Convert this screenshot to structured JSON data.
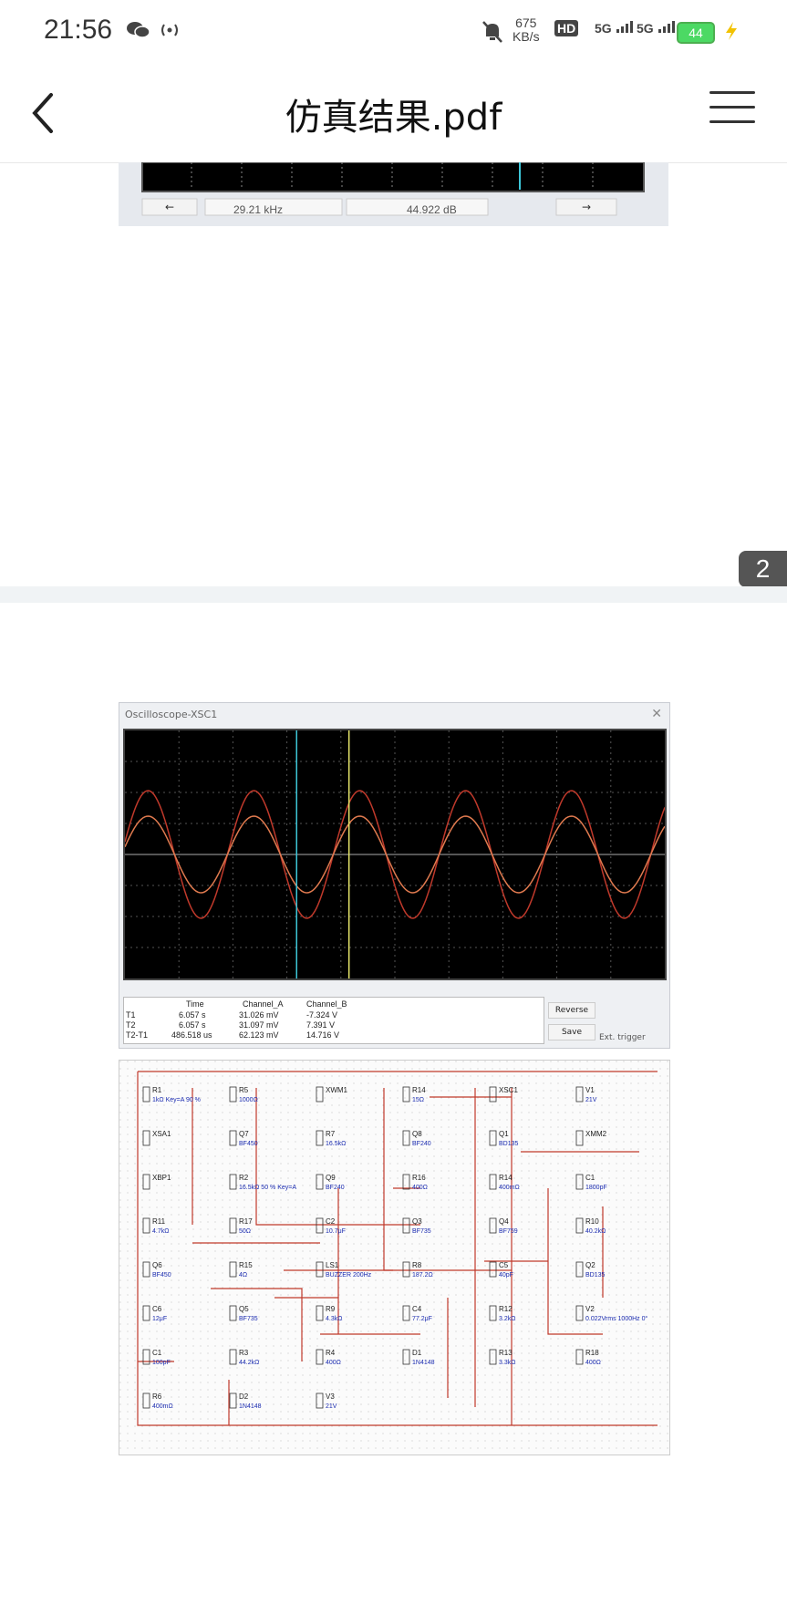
{
  "status_bar": {
    "time": "21:56",
    "net_speed_value": "675",
    "net_speed_unit": "KB/s",
    "hd_badge": "HD",
    "sim1": "5G",
    "sim2": "5G",
    "battery": "44"
  },
  "header": {
    "title": "仿真结果.pdf"
  },
  "page_indicator": "2",
  "analyzer": {
    "frequency": "29.21 kHz",
    "gain": "44.922 dB"
  },
  "oscilloscope": {
    "window_title": "Oscilloscope-XSC1",
    "columns": [
      "",
      "Time",
      "Channel_A",
      "Channel_B"
    ],
    "rows": [
      [
        "T1",
        "6.057 s",
        "31.026 mV",
        "-7.324 V"
      ],
      [
        "T2",
        "6.057 s",
        "31.097 mV",
        "7.391 V"
      ],
      [
        "T2-T1",
        "486.518 us",
        "62.123 mV",
        "14.716 V"
      ]
    ],
    "reverse_label": "Reverse",
    "save_label": "Save",
    "trigger_label": "Ext. trigger"
  },
  "circuit": {
    "labels": [
      {
        "text": "R1",
        "sub": "1kΩ Key=A 90 %"
      },
      {
        "text": "R5",
        "sub": "1000Ω"
      },
      {
        "text": "XWM1",
        "sub": ""
      },
      {
        "text": "R14",
        "sub": "15Ω"
      },
      {
        "text": "XSC1",
        "sub": ""
      },
      {
        "text": "V1",
        "sub": "21V"
      },
      {
        "text": "XSA1",
        "sub": ""
      },
      {
        "text": "Q7",
        "sub": "BF450"
      },
      {
        "text": "R7",
        "sub": "16.5kΩ"
      },
      {
        "text": "Q8",
        "sub": "BF240"
      },
      {
        "text": "Q1",
        "sub": "BD135"
      },
      {
        "text": "XMM2",
        "sub": ""
      },
      {
        "text": "XBP1",
        "sub": ""
      },
      {
        "text": "R2",
        "sub": "16.5kΩ 50 % Key=A"
      },
      {
        "text": "Q9",
        "sub": "BF240"
      },
      {
        "text": "R16",
        "sub": "400Ω"
      },
      {
        "text": "R14",
        "sub": "400mΩ"
      },
      {
        "text": "C1",
        "sub": "1800pF"
      },
      {
        "text": "R11",
        "sub": "4.7kΩ"
      },
      {
        "text": "R17",
        "sub": "50Ω"
      },
      {
        "text": "C2",
        "sub": "10.7μF"
      },
      {
        "text": "Q3",
        "sub": "BF735"
      },
      {
        "text": "Q4",
        "sub": "BF759"
      },
      {
        "text": "R10",
        "sub": "40.2kΩ"
      },
      {
        "text": "Q6",
        "sub": "BF450"
      },
      {
        "text": "R15",
        "sub": "4Ω"
      },
      {
        "text": "LS1",
        "sub": "BUZZER 200Hz"
      },
      {
        "text": "R8",
        "sub": "187.2Ω"
      },
      {
        "text": "C5",
        "sub": "40pF"
      },
      {
        "text": "Q2",
        "sub": "BD135"
      },
      {
        "text": "C6",
        "sub": "12μF"
      },
      {
        "text": "Q5",
        "sub": "BF735"
      },
      {
        "text": "R9",
        "sub": "4.3kΩ"
      },
      {
        "text": "C4",
        "sub": "77.2μF"
      },
      {
        "text": "R12",
        "sub": "3.2kΩ"
      },
      {
        "text": "V2",
        "sub": "0.022Vrms 1000Hz 0°"
      },
      {
        "text": "C1",
        "sub": "100pF"
      },
      {
        "text": "R3",
        "sub": "44.2kΩ"
      },
      {
        "text": "R4",
        "sub": "400Ω"
      },
      {
        "text": "D1",
        "sub": "1N4148"
      },
      {
        "text": "R13",
        "sub": "3.3kΩ"
      },
      {
        "text": "R18",
        "sub": "400Ω"
      },
      {
        "text": "R6",
        "sub": "400mΩ"
      },
      {
        "text": "D2",
        "sub": "1N4148"
      },
      {
        "text": "V3",
        "sub": "21V"
      }
    ]
  },
  "colors": {
    "trace_a": "#c0392b",
    "trace_b": "#e07a4f",
    "cursor_1": "#3ec6d8",
    "cursor_2": "#e6e66a",
    "wire": "#c0392b",
    "component": "#1a2bb0"
  }
}
